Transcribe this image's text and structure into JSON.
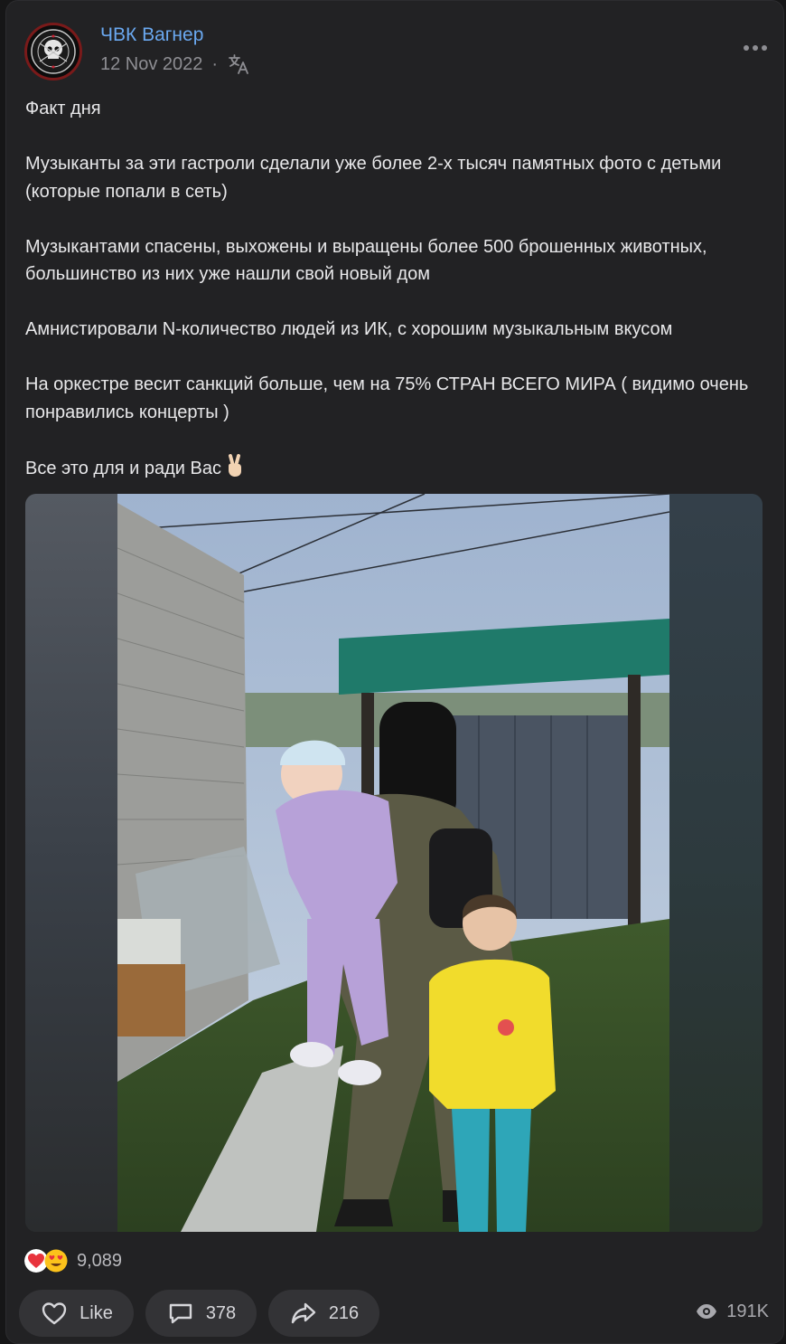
{
  "channel": {
    "name": "ЧВК Вагнер",
    "date": "12 Nov 2022",
    "separator": "·",
    "avatar_text_top": "PMC Wagner Group",
    "avatar_text_bottom": "Группа Вагнера"
  },
  "post": {
    "paragraphs": [
      "Факт дня",
      "Музыканты за эти гастроли сделали уже более 2-х тысяч памятных фото с детьми (которые попали в сеть)",
      "Музыкантами спасены, выхожены и выращены более 500 брошенных животных, большинство из них уже нашли свой новый дом",
      "Амнистировали N-количество людей из ИК, с хорошим музыкальным вкусом",
      "На оркестре весит санкций больше, чем на 75% СТРАН ВСЕГО МИРА ( видимо очень понравились концерты )",
      "Все это для и ради Вас"
    ],
    "closing_emoji": "victory-hand"
  },
  "reactions": {
    "icons": [
      "red-heart",
      "heart-eyes-face"
    ],
    "count": "9,089"
  },
  "actions": {
    "like_label": "Like",
    "comments_count": "378",
    "shares_count": "216",
    "views_count": "191K"
  },
  "colors": {
    "background": "#161617",
    "card": "#222224",
    "link": "#6aa8f0",
    "pill": "#333336"
  }
}
